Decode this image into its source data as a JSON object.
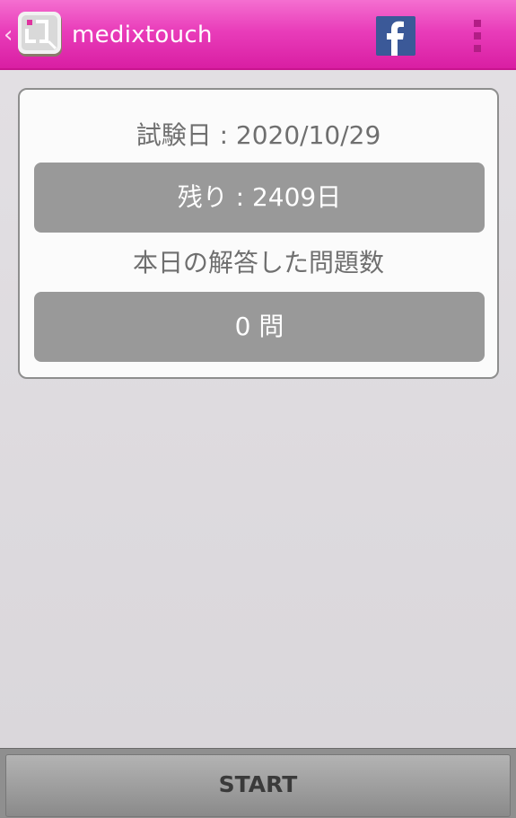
{
  "action_bar": {
    "title": "medixtouch",
    "up_glyph": "‹",
    "logo_icon": "medixtouch-logo-icon",
    "facebook_icon": "facebook-icon",
    "overflow_icon": "overflow-menu-icon"
  },
  "card": {
    "exam_date_text": "試験日 : 2020/10/29",
    "remaining_text": "残り : 2409日",
    "answered_label": "本日の解答した問題数",
    "answered_count_text": "0 問"
  },
  "start_button": {
    "label": "START"
  },
  "colors": {
    "action_bar": "#e93dba",
    "pill": "#999999",
    "card_border": "#8e8e8e",
    "facebook": "#3b5998"
  }
}
